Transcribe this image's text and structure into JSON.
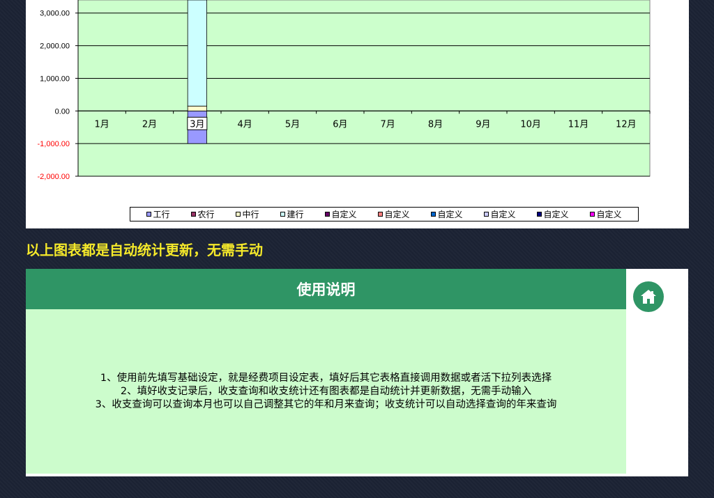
{
  "chart_data": {
    "type": "bar",
    "categories": [
      "1月",
      "2月",
      "3月",
      "4月",
      "5月",
      "6月",
      "7月",
      "8月",
      "9月",
      "10月",
      "11月",
      "12月"
    ],
    "y_ticks": [
      {
        "value": 3000,
        "label": "3,000.00"
      },
      {
        "value": 2000,
        "label": "2,000.00"
      },
      {
        "value": 1000,
        "label": "1,000.00"
      },
      {
        "value": 0,
        "label": "0.00"
      },
      {
        "value": -1000,
        "label": "-1,000.00"
      },
      {
        "value": -2000,
        "label": "-2,000.00"
      }
    ],
    "ylim": [
      -2000,
      3400
    ],
    "grid": true,
    "stacked": true,
    "highlighted_category": "3月",
    "series": [
      {
        "name": "工行",
        "color": "#9999ff",
        "values": [
          0,
          0,
          -1000,
          0,
          0,
          0,
          0,
          0,
          0,
          0,
          0,
          0
        ]
      },
      {
        "name": "农行",
        "color": "#993366",
        "values": [
          0,
          0,
          0,
          0,
          0,
          0,
          0,
          0,
          0,
          0,
          0,
          0
        ]
      },
      {
        "name": "中行",
        "color": "#ffffcc",
        "values": [
          0,
          0,
          150,
          0,
          0,
          0,
          0,
          0,
          0,
          0,
          0,
          0
        ]
      },
      {
        "name": "建行",
        "color": "#ccffff",
        "values": [
          0,
          0,
          3250,
          0,
          0,
          0,
          0,
          0,
          0,
          0,
          0,
          0
        ]
      },
      {
        "name": "自定义",
        "color": "#660066",
        "values": [
          0,
          0,
          0,
          0,
          0,
          0,
          0,
          0,
          0,
          0,
          0,
          0
        ]
      },
      {
        "name": "自定义",
        "color": "#ff8080",
        "values": [
          0,
          0,
          0,
          0,
          0,
          0,
          0,
          0,
          0,
          0,
          0,
          0
        ]
      },
      {
        "name": "自定义",
        "color": "#0066cc",
        "values": [
          0,
          0,
          0,
          0,
          0,
          0,
          0,
          0,
          0,
          0,
          0,
          0
        ]
      },
      {
        "name": "自定义",
        "color": "#ccccff",
        "values": [
          0,
          0,
          0,
          0,
          0,
          0,
          0,
          0,
          0,
          0,
          0,
          0
        ]
      },
      {
        "name": "自定义",
        "color": "#000080",
        "values": [
          0,
          0,
          0,
          0,
          0,
          0,
          0,
          0,
          0,
          0,
          0,
          0
        ]
      },
      {
        "name": "自定义",
        "color": "#ff00ff",
        "values": [
          0,
          0,
          0,
          0,
          0,
          0,
          0,
          0,
          0,
          0,
          0,
          0
        ]
      }
    ],
    "colors": {
      "plot_background": "#ccffcc",
      "negative_tick_label": "#ff0000",
      "positive_tick_label": "#000000"
    }
  },
  "caption": "以上图表都是自动统计更新，无需手动",
  "instructions": {
    "title": "使用说明",
    "lines": [
      "1、使用前先填写基础设定，就是经费项目设定表，填好后其它表格直接调用数据或者活下拉列表选择",
      "2、填好收支记录后，收支查询和收支统计还有图表都是自动统计并更新数据，无需手动输入",
      "3、收支查询可以查询本月也可以自己调整其它的年和月来查询；收支统计可以自动选择查询的年来查询"
    ],
    "home_icon": "home-icon",
    "colors": {
      "header": "#2f9565",
      "body": "#ccfccc"
    }
  }
}
